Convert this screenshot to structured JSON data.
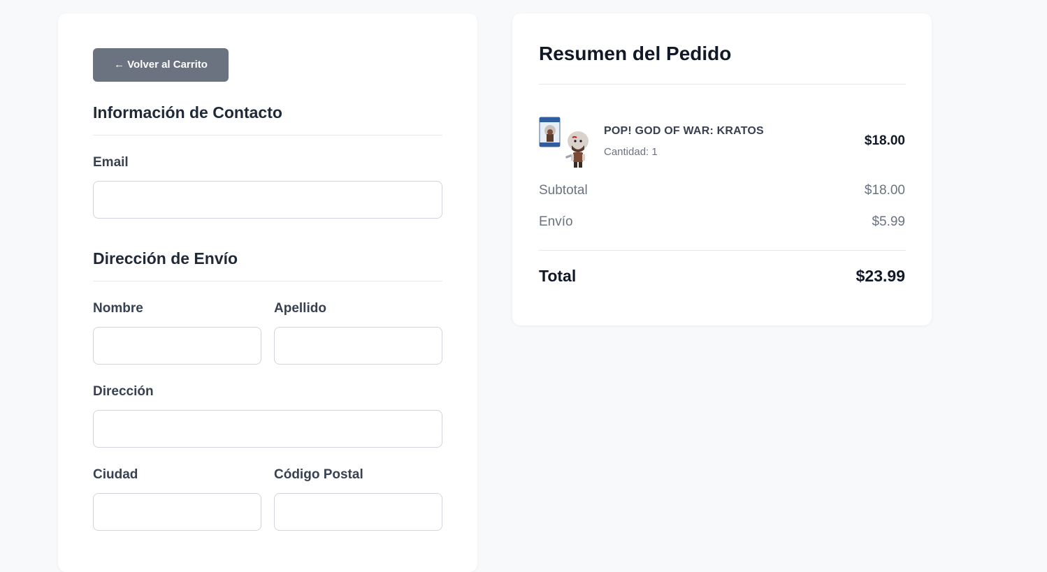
{
  "checkout": {
    "back_button_label": "← Volver al Carrito",
    "contact": {
      "title": "Información de Contacto",
      "email_label": "Email",
      "email_value": "",
      "email_placeholder": ""
    },
    "shipping": {
      "title": "Dirección de Envío",
      "first_name_label": "Nombre",
      "first_name_value": "",
      "last_name_label": "Apellido",
      "last_name_value": "",
      "address_label": "Dirección",
      "address_value": "",
      "city_label": "Ciudad",
      "city_value": "",
      "postal_code_label": "Código Postal",
      "postal_code_value": ""
    }
  },
  "summary": {
    "title": "Resumen del Pedido",
    "item": {
      "name": "POP! GOD OF WAR: KRATOS",
      "quantity": "Cantidad: 1",
      "price": "$18.00",
      "image_icon": "funko-pop-kratos-product-image"
    },
    "subtotal_label": "Subtotal",
    "subtotal_value": "$18.00",
    "shipping_label": "Envío",
    "shipping_value": "$5.99",
    "total_label": "Total",
    "total_value": "$23.99"
  },
  "colors": {
    "page_background": "#f8f9fa",
    "card_background": "#ffffff",
    "back_button": "#6b7280",
    "text_primary": "#111827",
    "text_muted": "#6b7280",
    "border": "#d1d5db"
  }
}
